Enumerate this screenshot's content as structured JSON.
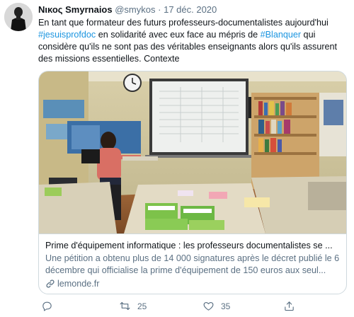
{
  "author": {
    "name": "Νικος Smyrnaios",
    "handle": "@smykos",
    "separator": "·",
    "date": "17 déc. 2020"
  },
  "tweet": {
    "part1": "En tant que formateur des futurs professeurs-documentalistes aujourd'hui ",
    "hashtag1": "#jesuisprofdoc",
    "part2": " en solidarité avec eux face au mépris de ",
    "hashtag2": "#Blanquer",
    "part3": " qui considère qu'ils ne sont pas des véritables enseignants alors qu'ils assurent des missions essentielles. Contexte"
  },
  "card": {
    "title": "Prime d'équipement informatique : les professeurs documentalistes se ...",
    "description": "Une pétition a obtenu plus de 14 000 signatures après le décret publié le 6 décembre qui officialise la prime d'équipement de 150 euros aux seul...",
    "domain": "lemonde.fr",
    "image_alt": "Salle de classe avec une enseignante devant un tableau interactif"
  },
  "actions": {
    "reply_count": "",
    "retweet_count": "25",
    "like_count": "35",
    "share_count": ""
  },
  "colors": {
    "link": "#1b95e0",
    "secondary_text": "#5b7083",
    "border": "#cfd9de"
  }
}
